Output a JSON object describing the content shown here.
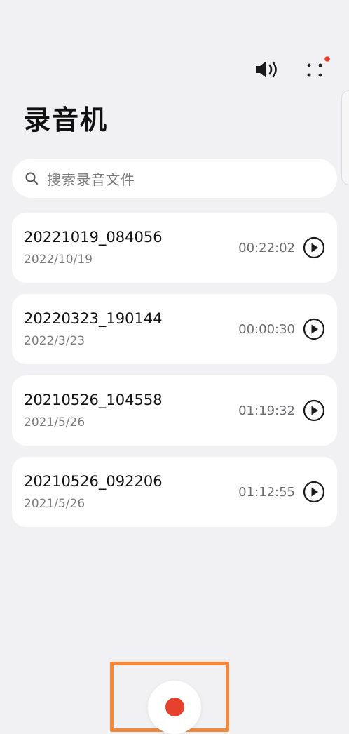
{
  "app": {
    "title": "录音机"
  },
  "topbar": {
    "speaker_icon": "speaker-volume-icon",
    "more_icon": "more-dots-icon",
    "notification_dot_color": "#e5412c"
  },
  "search": {
    "icon": "search-icon",
    "placeholder": "搜索录音文件"
  },
  "recordings": [
    {
      "name": "20221019_084056",
      "date": "2022/10/19",
      "duration": "00:22:02"
    },
    {
      "name": "20220323_190144",
      "date": "2022/3/23",
      "duration": "00:00:30"
    },
    {
      "name": "20210526_104558",
      "date": "2021/5/26",
      "duration": "01:19:32"
    },
    {
      "name": "20210526_092206",
      "date": "2021/5/26",
      "duration": "01:12:55"
    }
  ],
  "record_button": {
    "color": "#e5412c",
    "highlight_color": "#f2883b"
  },
  "colors": {
    "background": "#f1f1f3",
    "card": "#ffffff"
  }
}
